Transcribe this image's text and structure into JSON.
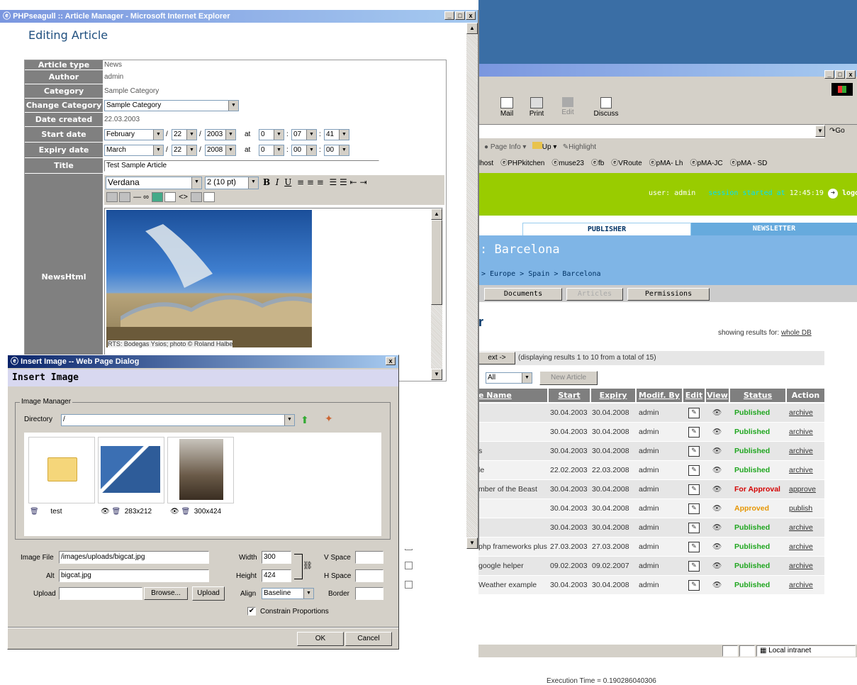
{
  "back_window": {
    "toolbar": {
      "mail": "Mail",
      "print": "Print",
      "edit": "Edit",
      "discuss": "Discuss"
    },
    "address_go": "Go",
    "links_bar": {
      "page_info": "Page Info",
      "up": "Up",
      "highlight": "Highlight"
    },
    "favorites": [
      "lhost",
      "PHPkitchen",
      "muse23",
      "fb",
      "VRoute",
      "pMA- Lh",
      "pMA-JC",
      "pMA - SD"
    ],
    "header": {
      "user_label": "user:",
      "user": "admin",
      "session_label": "session started at",
      "time": "12:45:19",
      "logout": "logout"
    },
    "tabs": [
      "PUBLISHER",
      "NEWSLETTER"
    ],
    "section_title": ": Barcelona",
    "breadcrumb": "> Europe > Spain > Barcelona",
    "subtabs": [
      "Documents",
      "Articles",
      "Permissions"
    ],
    "page_title_tail": "r",
    "showing_label": "showing results for:",
    "showing_value": "whole DB",
    "paging": {
      "next": "ext ->",
      "info": "(displaying results 1 to 10 from a total of 15)"
    },
    "filter": {
      "value": "All",
      "new_article": "New Article"
    },
    "columns": [
      "e Name",
      "Start",
      "Expiry",
      "Modif. By",
      "Edit",
      "View",
      "Status",
      "Action"
    ],
    "rows": [
      {
        "name": "",
        "start": "30.04.2003",
        "expiry": "30.04.2008",
        "by": "admin",
        "status": "Published",
        "status_type": "pub",
        "action": "archive"
      },
      {
        "name": "",
        "start": "30.04.2003",
        "expiry": "30.04.2008",
        "by": "admin",
        "status": "Published",
        "status_type": "pub",
        "action": "archive"
      },
      {
        "name": "s",
        "start": "30.04.2003",
        "expiry": "30.04.2008",
        "by": "admin",
        "status": "Published",
        "status_type": "pub",
        "action": "archive"
      },
      {
        "name": "le",
        "start": "22.02.2003",
        "expiry": "22.03.2008",
        "by": "admin",
        "status": "Published",
        "status_type": "pub",
        "action": "archive"
      },
      {
        "name": "mber of the Beast",
        "start": "30.04.2003",
        "expiry": "30.04.2008",
        "by": "admin",
        "status": "For Approval",
        "status_type": "forappr",
        "action": "approve"
      },
      {
        "name": "",
        "start": "30.04.2003",
        "expiry": "30.04.2008",
        "by": "admin",
        "status": "Approved",
        "status_type": "appr",
        "action": "publish"
      },
      {
        "name": "",
        "start": "30.04.2003",
        "expiry": "30.04.2008",
        "by": "admin",
        "status": "Published",
        "status_type": "pub",
        "action": "archive"
      },
      {
        "name": "php frameworks plus",
        "start": "27.03.2003",
        "expiry": "27.03.2008",
        "by": "admin",
        "status": "Published",
        "status_type": "pub",
        "action": "archive"
      },
      {
        "name": "google helper",
        "start": "09.02.2003",
        "expiry": "09.02.2007",
        "by": "admin",
        "status": "Published",
        "status_type": "pub",
        "action": "archive"
      },
      {
        "name": "Weather example",
        "start": "30.04.2003",
        "expiry": "30.04.2008",
        "by": "admin",
        "status": "Published",
        "status_type": "pub",
        "action": "archive"
      }
    ],
    "exec_time": "Execution Time = 0.190286040306",
    "status_zone": "Local intranet"
  },
  "front_window": {
    "title": "PHPseagull :: Article Manager - Microsoft Internet Explorer",
    "heading": "Editing Article",
    "labels": {
      "type": "Article type",
      "author": "Author",
      "category": "Category",
      "change_category": "Change Category",
      "date_created": "Date created",
      "start_date": "Start date",
      "expiry_date": "Expiry date",
      "title": "Title",
      "newshtml": "NewsHtml"
    },
    "values": {
      "type": "News",
      "author": "admin",
      "category": "Sample Category",
      "change_category": "Sample Category",
      "date_created": "22.03.2003",
      "title": "Test Sample Article"
    },
    "start": {
      "month": "February",
      "day": "22",
      "year": "2003",
      "at": "at",
      "h": "0",
      "m": "07",
      "s": "41"
    },
    "expiry": {
      "month": "March",
      "day": "22",
      "year": "2008",
      "at": "at",
      "h": "0",
      "m": "00",
      "s": "00"
    },
    "editor": {
      "font": "Verdana",
      "size": "2 (10 pt)",
      "caption": "RTS: Bodegas Ysios; photo © Roland Halbe"
    }
  },
  "dialog": {
    "title": "Insert Image -- Web Page Dialog",
    "heading": "Insert Image",
    "group": "Image Manager",
    "directory_label": "Directory",
    "directory_value": "/",
    "thumbs": [
      {
        "label": "test"
      },
      {
        "label": "283x212"
      },
      {
        "label": "300x424"
      }
    ],
    "image_file_label": "Image File",
    "image_file": "/images/uploads/bigcat.jpg",
    "alt_label": "Alt",
    "alt": "bigcat.jpg",
    "upload_label": "Upload",
    "browse": "Browse...",
    "upload_btn": "Upload",
    "width_label": "Width",
    "width": "300",
    "height_label": "Height",
    "height": "424",
    "align_label": "Align",
    "align": "Baseline",
    "vspace_label": "V Space",
    "hspace_label": "H Space",
    "border_label": "Border",
    "constrain": "Constrain Proportions",
    "ok": "OK",
    "cancel": "Cancel"
  }
}
